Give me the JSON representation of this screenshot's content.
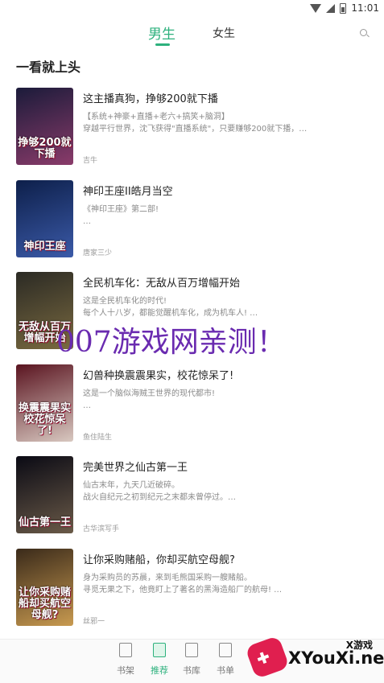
{
  "status_bar": {
    "time": "11:01"
  },
  "tabs": [
    {
      "label": "男生",
      "active": true
    },
    {
      "label": "女生",
      "active": false
    }
  ],
  "section_title": "一看就上头",
  "books": [
    {
      "title": "这主播真狗，挣够200就下播",
      "desc1": "【系统+神豪+直播+老六+搞笑+脑洞】",
      "desc2": "穿越平行世界，沈飞获得\"直播系统\"，只要赚够200就下播，…",
      "desc3": "",
      "author": "吉牛",
      "cover_text": "挣够200就下播",
      "cover_colors": [
        "#1b1b3a",
        "#8a3b6a"
      ]
    },
    {
      "title": "神印王座II皓月当空",
      "desc1": "《神印王座》第二部!",
      "desc2": "…",
      "desc3": "",
      "author": "唐家三少",
      "cover_text": "神印王座",
      "cover_colors": [
        "#0d1f4a",
        "#3b5aa8"
      ]
    },
    {
      "title": "全民机车化：无敌从百万增幅开始",
      "desc1": "这是全民机车化的时代!",
      "desc2": "每个人十八岁，都能觉醒机车化，成为机车人! …",
      "desc3": "",
      "author": "",
      "cover_text": "无敌从百万增幅开始",
      "cover_colors": [
        "#2b2a24",
        "#7a6a40"
      ]
    },
    {
      "title": "幻兽种换震震果实，校花惊呆了!",
      "desc1": "这是一个脑似海贼王世界的现代都市!",
      "desc2": "…",
      "desc3": "",
      "author": "鱼住陆生",
      "cover_text": "换震震果实 校花惊呆了!",
      "cover_colors": [
        "#5a1420",
        "#d8c8c0"
      ]
    },
    {
      "title": "完美世界之仙古第一王",
      "desc1": "仙古末年，九天几近破碎。",
      "desc2": "战火自纪元之初到纪元之末都未曾停过。…",
      "desc3": "",
      "author": "古华滨写手",
      "cover_text": "仙古第一王",
      "cover_colors": [
        "#0a0a14",
        "#6a5a48"
      ]
    },
    {
      "title": "让你采购赌船，你却买航空母舰?",
      "desc1": "身为采购员的苏晨，来到毛熊国采购一艘赌船。",
      "desc2": "寻觅无果之下，他竟盯上了著名的黑海造船厂的航母! …",
      "desc3": "",
      "author": "丝邪一",
      "cover_text": "让你采购赌船却买航空母舰?",
      "cover_colors": [
        "#3a2a1a",
        "#c89a50"
      ]
    }
  ],
  "watermark": "007游戏网亲测！",
  "bottom_nav": [
    {
      "label": "书架",
      "active": false
    },
    {
      "label": "推荐",
      "active": true
    },
    {
      "label": "书库",
      "active": false
    },
    {
      "label": "书单",
      "active": false
    }
  ],
  "logo": {
    "small": "X游戏",
    "main": "XYouXi.net"
  },
  "colors": {
    "accent": "#2db17d",
    "watermark": "#6a2bb0",
    "logo_pad": "#e01f4f"
  }
}
